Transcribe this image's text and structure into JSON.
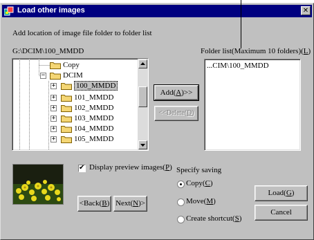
{
  "window": {
    "title": "Load other images",
    "close_glyph": "✕"
  },
  "instruction": "Add location of image file folder to folder list",
  "current_path": "G:\\DCIM\\100_MMDD",
  "folder_list": {
    "label_prefix": "Folder list(Maximum 10 folders)(",
    "label_key": "L",
    "label_suffix": ")",
    "items": [
      "...CIM\\100_MMDD"
    ]
  },
  "tree": {
    "items": [
      {
        "label": "Copy",
        "expander": "",
        "selected": false
      },
      {
        "label": "DCIM",
        "expander": "−",
        "selected": false
      },
      {
        "label": "100_MMDD",
        "expander": "+",
        "selected": true
      },
      {
        "label": "101_MMDD",
        "expander": "+",
        "selected": false
      },
      {
        "label": "102_MMDD",
        "expander": "+",
        "selected": false
      },
      {
        "label": "103_MMDD",
        "expander": "+",
        "selected": false
      },
      {
        "label": "104_MMDD",
        "expander": "+",
        "selected": false
      },
      {
        "label": "105_MMDD",
        "expander": "+",
        "selected": false
      }
    ]
  },
  "buttons": {
    "add": {
      "prefix": "Add(",
      "key": "A",
      "suffix": ")>>"
    },
    "delete": {
      "prefix": "<<Delete(",
      "key": "D",
      "suffix": ")"
    },
    "back": {
      "prefix": "<Back(",
      "key": "B",
      "suffix": ")"
    },
    "next": {
      "prefix": "Next(",
      "key": "N",
      "suffix": ")>"
    },
    "load": {
      "prefix": "Load(",
      "key": "G",
      "suffix": ")"
    },
    "cancel": {
      "label": "Cancel"
    }
  },
  "preview_checkbox": {
    "prefix": "Display preview images(",
    "key": "P",
    "suffix": ")",
    "checked": true,
    "check_glyph": "✔"
  },
  "saving": {
    "title": "Specify saving",
    "options": [
      {
        "prefix": "Copy(",
        "key": "C",
        "suffix": ")",
        "selected": true
      },
      {
        "prefix": "Move(",
        "key": "M",
        "suffix": ")",
        "selected": false
      },
      {
        "prefix": "Create shortcut(",
        "key": "S",
        "suffix": ")",
        "selected": false
      }
    ]
  },
  "colors": {
    "titlebar": "#000080",
    "face": "#c0c0c0",
    "selection": "#c0c0c0",
    "folder": "#f4d675"
  },
  "icons": {
    "title": "app-icon",
    "folder": "folder-icon",
    "preview": "flower-thumbnail"
  }
}
